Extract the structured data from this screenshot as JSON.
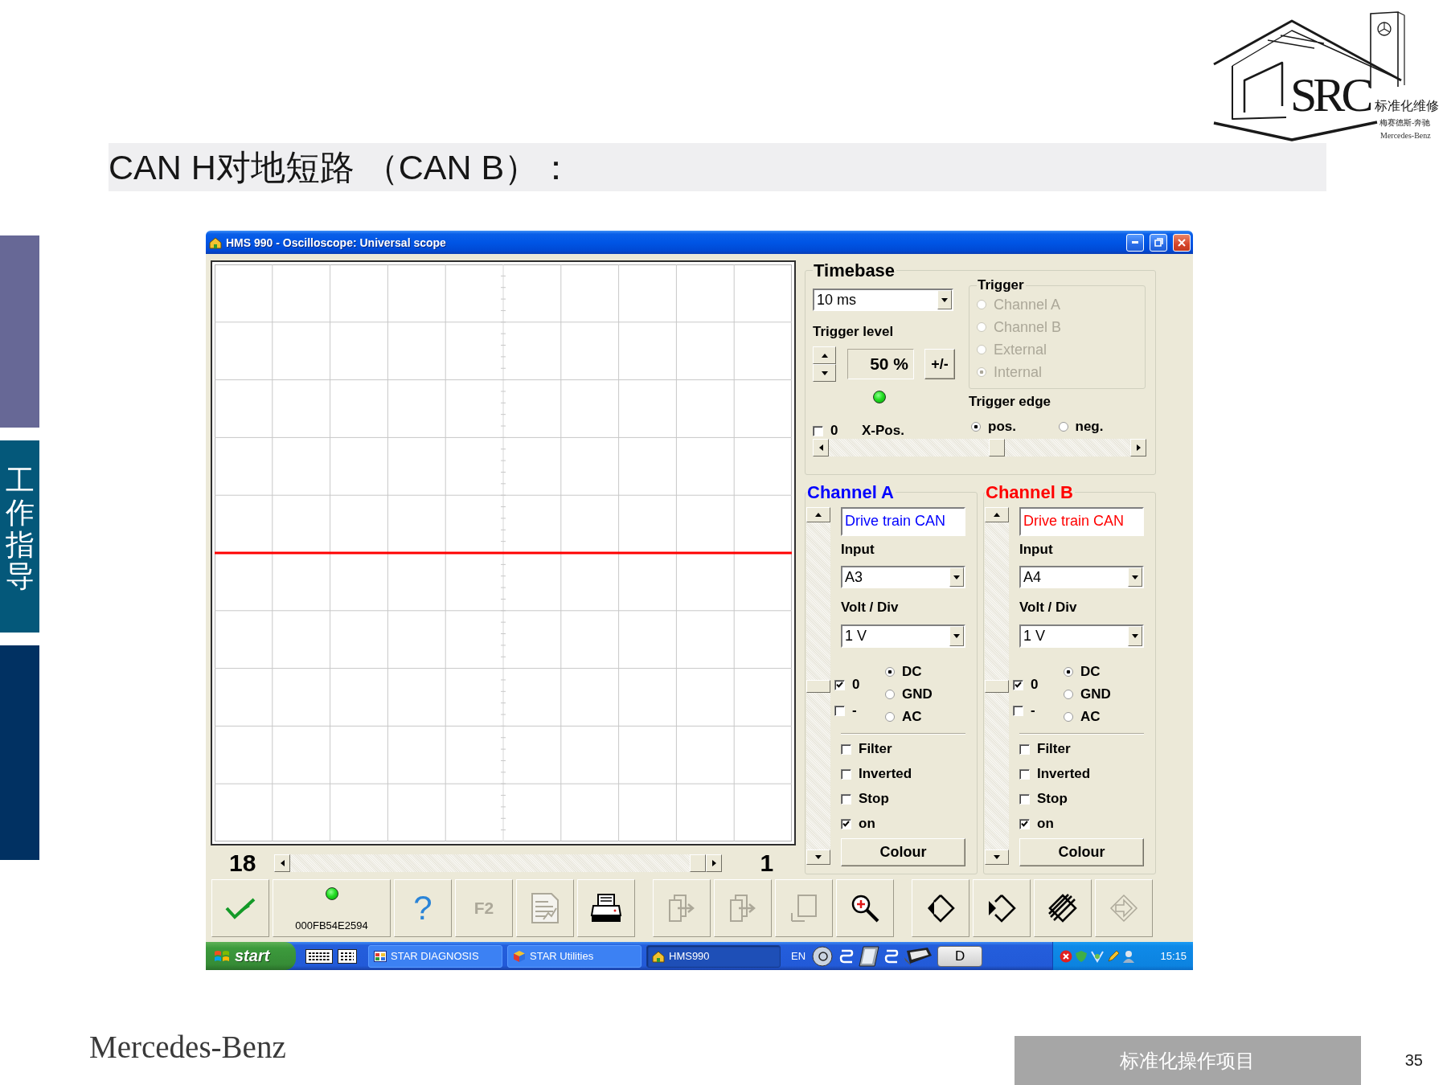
{
  "slide": {
    "title": "CAN H对地短路 （CAN B）：",
    "side_label": "工作指导"
  },
  "logo": {
    "letters": "SRC",
    "tagline": "标准化维修",
    "subtitle": "梅赛德斯-奔驰",
    "brand": "Mercedes-Benz"
  },
  "window": {
    "title": "HMS 990 - Oscilloscope: Universal scope"
  },
  "timebase": {
    "title": "Timebase",
    "value": "10 ms",
    "trigger_level_label": "Trigger level",
    "trigger_level": "50 %",
    "invert_button": "+/-",
    "trigger_led_on": true,
    "xpos_zero": {
      "label": "0",
      "checked": false
    },
    "xpos_label": "X-Pos.",
    "xpos": {
      "level": 0.56
    },
    "trigger": {
      "title": "Trigger",
      "disabled": true,
      "sources": [
        {
          "label": "Channel A",
          "selected": false
        },
        {
          "label": "Channel B",
          "selected": false
        },
        {
          "label": "External",
          "selected": false
        },
        {
          "label": "Internal",
          "selected": true
        }
      ]
    },
    "trigger_edge": {
      "title": "Trigger edge",
      "options": [
        {
          "label": "pos.",
          "selected": true
        },
        {
          "label": "neg.",
          "selected": false
        }
      ]
    }
  },
  "channels": [
    {
      "title": "Channel A",
      "color": "#0000ff",
      "name": "Drive train CAN",
      "input_label": "Input",
      "input": "A3",
      "volt_label": "Volt / Div",
      "volt": "1 V",
      "offset": {
        "level": 0.5
      },
      "zero": {
        "label": "0",
        "checked": true
      },
      "negate": {
        "label": "-",
        "checked": false
      },
      "coupling": [
        {
          "label": "DC",
          "selected": true
        },
        {
          "label": "GND",
          "selected": false
        },
        {
          "label": "AC",
          "selected": false
        }
      ],
      "options": [
        {
          "label": "Filter",
          "checked": false
        },
        {
          "label": "Inverted",
          "checked": false
        },
        {
          "label": "Stop",
          "checked": false
        },
        {
          "label": "on",
          "checked": true
        }
      ],
      "colour_button": "Colour"
    },
    {
      "title": "Channel B",
      "color": "#ff0000",
      "name": "Drive train CAN",
      "input_label": "Input",
      "input": "A4",
      "volt_label": "Volt / Div",
      "volt": "1 V",
      "offset": {
        "level": 0.5
      },
      "zero": {
        "label": "0",
        "checked": true
      },
      "negate": {
        "label": "-",
        "checked": false
      },
      "coupling": [
        {
          "label": "DC",
          "selected": true
        },
        {
          "label": "GND",
          "selected": false
        },
        {
          "label": "AC",
          "selected": false
        }
      ],
      "options": [
        {
          "label": "Filter",
          "checked": false
        },
        {
          "label": "Inverted",
          "checked": false
        },
        {
          "label": "Stop",
          "checked": false
        },
        {
          "label": "on",
          "checked": true
        }
      ],
      "colour_button": "Colour"
    }
  ],
  "frames": {
    "count": "18",
    "current": "1",
    "level": 1
  },
  "toolbar": {
    "groups": [
      [
        {
          "kind": "confirm",
          "disabled": false
        },
        {
          "kind": "status",
          "serial": "000FB54E2594",
          "led_on": true
        },
        {
          "kind": "help",
          "label": "?",
          "disabled": false
        },
        {
          "kind": "key",
          "label": "F2",
          "disabled": true
        },
        {
          "kind": "report",
          "disabled": true
        },
        {
          "kind": "print",
          "disabled": false
        }
      ],
      [
        {
          "kind": "export",
          "disabled": true
        },
        {
          "kind": "import",
          "disabled": true
        },
        {
          "kind": "page",
          "disabled": true
        },
        {
          "kind": "zoom",
          "disabled": false
        }
      ],
      [
        {
          "kind": "prev",
          "disabled": false
        },
        {
          "kind": "next",
          "disabled": false
        },
        {
          "kind": "clear",
          "disabled": false
        },
        {
          "kind": "exit",
          "disabled": true
        }
      ]
    ]
  },
  "taskbar": {
    "start": "start",
    "tasks": [
      {
        "label": "STAR DIAGNOSIS",
        "selected": false
      },
      {
        "label": "STAR Utilities",
        "selected": false
      },
      {
        "label": "HMS990",
        "selected": true
      }
    ],
    "language": "EN",
    "drive": "D",
    "clock": "15:15"
  },
  "footer": {
    "brand": "Mercedes-Benz",
    "section": "标准化操作项目",
    "page": "35"
  }
}
